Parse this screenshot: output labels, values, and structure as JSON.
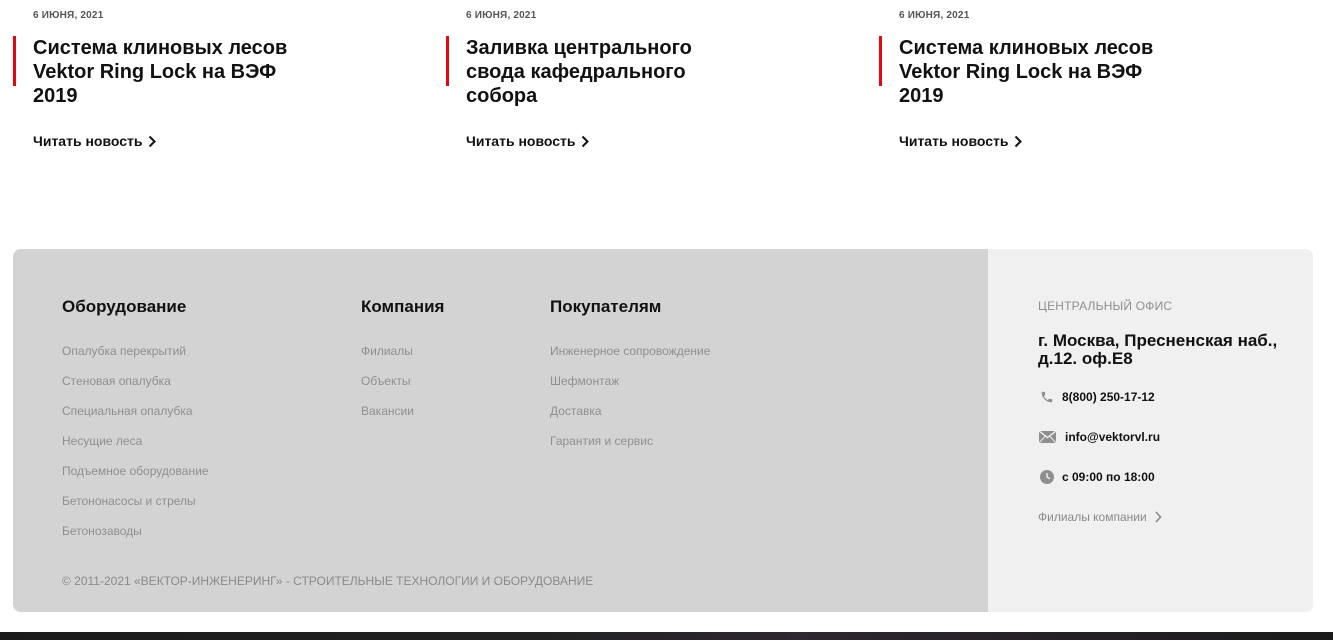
{
  "news": [
    {
      "date": "6 июня, 2021",
      "title": "Система клиновых лесов Vektor Ring Lock на ВЭФ 2019",
      "read_label": "Читать новость"
    },
    {
      "date": "6 июня, 2021",
      "title": "Заливка центрального свода кафедрального собора",
      "read_label": "Читать новость"
    },
    {
      "date": "6 июня, 2021",
      "title": "Система клиновых лесов Vektor Ring Lock на ВЭФ 2019",
      "read_label": "Читать новость"
    }
  ],
  "footer": {
    "columns": [
      {
        "heading": "Оборудование",
        "items": [
          "Опалубка перекрытий",
          "Стеновая опалубка",
          "Специальная опалубка",
          "Несущие леса",
          "Подъемное оборудование",
          "Бетононасосы и стрелы",
          "Бетонозаводы"
        ]
      },
      {
        "heading": "Компания",
        "items": [
          "Филиалы",
          "Объекты",
          "Вакансии"
        ]
      },
      {
        "heading": "Покупателям",
        "items": [
          "Инженерное сопровождение",
          "Шефмонтаж",
          "Доставка",
          "Гарантия и сервис"
        ]
      }
    ],
    "copyright": "© 2011-2021 «ВЕКТОР-ИНЖЕНЕРИНГ» - СТРОИТЕЛЬНЫЕ ТЕХНОЛОГИИ И ОБОРУДОВАНИЕ",
    "office": {
      "label": "ЦЕНТРАЛЬНЫЙ ОФИС",
      "address": "г. Москва, Пресненская наб., д.12. оф.Е8",
      "phone": "8(800) 250-17-12",
      "email": "info@vektorvl.ru",
      "hours": "с 09:00 по 18:00",
      "branches_link": "Филиалы компании"
    }
  },
  "colors": {
    "accent": "#e30613",
    "footer_bg": "#d3d3d3",
    "office_bg": "#f0f0f0",
    "muted_text": "#8f8f8f"
  },
  "icons": {
    "read_more": "chevron-right-icon",
    "phone": "phone-icon",
    "email": "envelope-icon",
    "hours": "clock-icon",
    "branches": "chevron-right-icon"
  }
}
